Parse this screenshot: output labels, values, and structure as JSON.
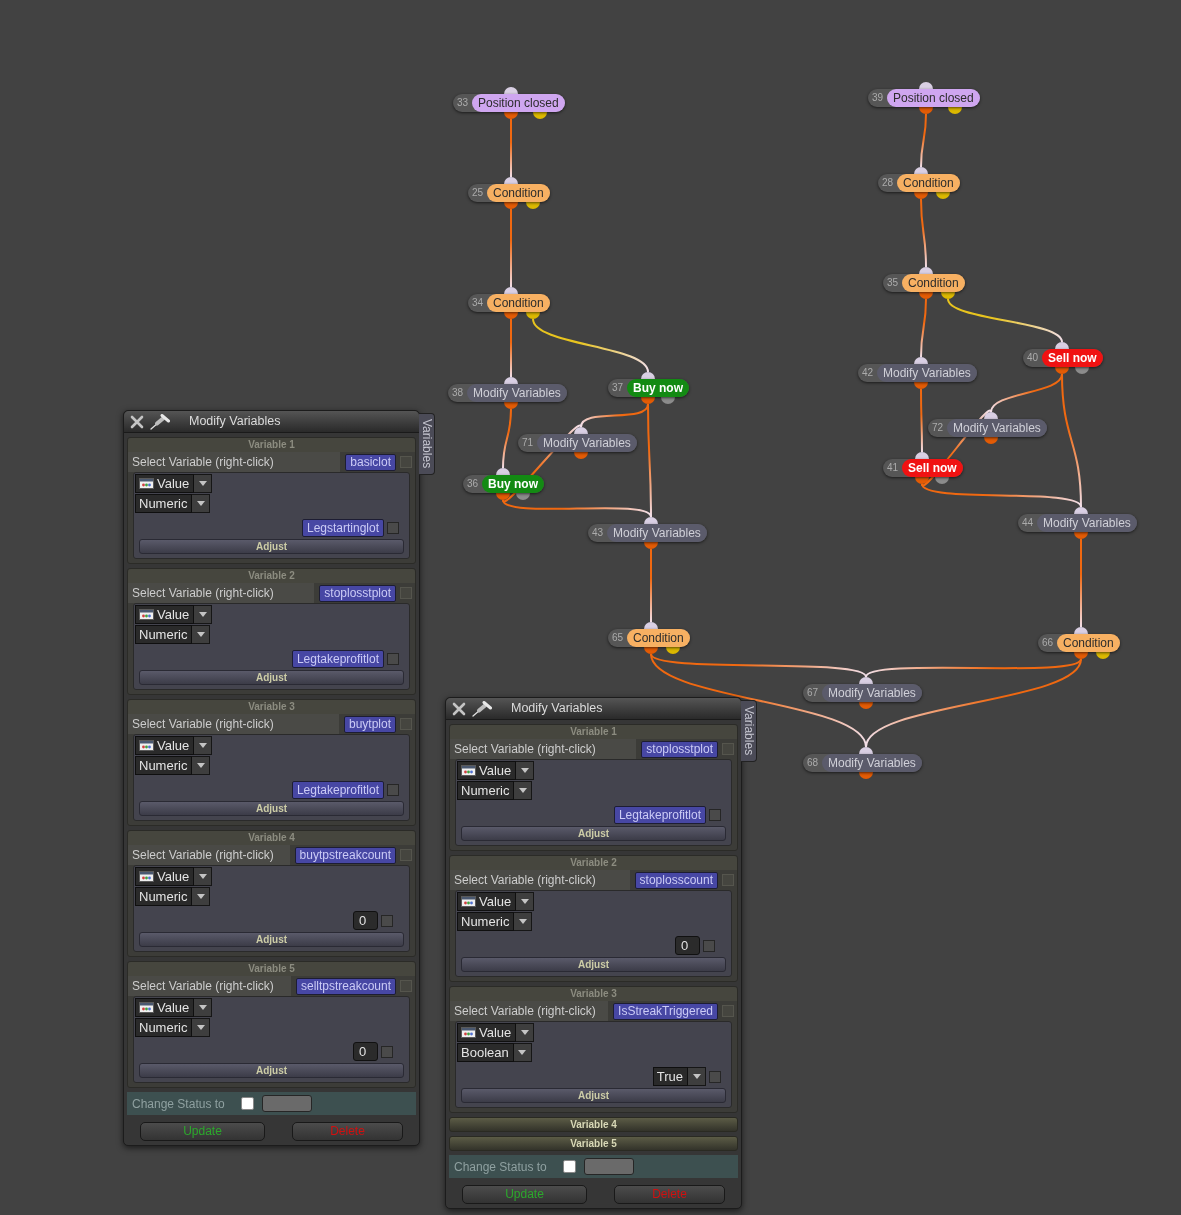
{
  "canvas": {
    "nodes": [
      {
        "number": "33",
        "label": "Position closed",
        "kind": "trigger"
      },
      {
        "number": "25",
        "label": "Condition",
        "kind": "condition"
      },
      {
        "number": "34",
        "label": "Condition",
        "kind": "condition"
      },
      {
        "number": "38",
        "label": "Modify Variables",
        "kind": "modify"
      },
      {
        "number": "37",
        "label": "Buy now",
        "kind": "buy"
      },
      {
        "number": "71",
        "label": "Modify Variables",
        "kind": "modify"
      },
      {
        "number": "36",
        "label": "Buy now",
        "kind": "buy"
      },
      {
        "number": "43",
        "label": "Modify Variables",
        "kind": "modify"
      },
      {
        "number": "39",
        "label": "Position closed",
        "kind": "trigger"
      },
      {
        "number": "28",
        "label": "Condition",
        "kind": "condition"
      },
      {
        "number": "35",
        "label": "Condition",
        "kind": "condition"
      },
      {
        "number": "42",
        "label": "Modify Variables",
        "kind": "modify"
      },
      {
        "number": "40",
        "label": "Sell now",
        "kind": "sell"
      },
      {
        "number": "72",
        "label": "Modify Variables",
        "kind": "modify"
      },
      {
        "number": "41",
        "label": "Sell now",
        "kind": "sell"
      },
      {
        "number": "44",
        "label": "Modify Variables",
        "kind": "modify"
      },
      {
        "number": "65",
        "label": "Condition",
        "kind": "condition"
      },
      {
        "number": "66",
        "label": "Condition",
        "kind": "condition"
      },
      {
        "number": "67",
        "label": "Modify Variables",
        "kind": "modify"
      },
      {
        "number": "68",
        "label": "Modify Variables",
        "kind": "modify"
      }
    ]
  },
  "panels": [
    {
      "title": "Modify Variables",
      "side_tab": "Variables",
      "variables": [
        {
          "title": "Variable 1",
          "expanded": true,
          "select_label": "Select Variable (right-click)",
          "variable": "basiclot",
          "variable_checked": false,
          "source": "Value",
          "type": "Numeric",
          "value": {
            "kind": "variable",
            "text": "Legstartinglot",
            "checked": false
          },
          "adjust": "Adjust"
        },
        {
          "title": "Variable 2",
          "expanded": true,
          "select_label": "Select Variable (right-click)",
          "variable": "stoplosstplot",
          "variable_checked": false,
          "source": "Value",
          "type": "Numeric",
          "value": {
            "kind": "variable",
            "text": "Legtakeprofitlot",
            "checked": false
          },
          "adjust": "Adjust"
        },
        {
          "title": "Variable 3",
          "expanded": true,
          "select_label": "Select Variable (right-click)",
          "variable": "buytplot",
          "variable_checked": false,
          "source": "Value",
          "type": "Numeric",
          "value": {
            "kind": "variable",
            "text": "Legtakeprofitlot",
            "checked": false
          },
          "adjust": "Adjust"
        },
        {
          "title": "Variable 4",
          "expanded": true,
          "select_label": "Select Variable (right-click)",
          "variable": "buytpstreakcount",
          "variable_checked": false,
          "source": "Value",
          "type": "Numeric",
          "value": {
            "kind": "number",
            "text": "0",
            "checked": false
          },
          "adjust": "Adjust"
        },
        {
          "title": "Variable 5",
          "expanded": true,
          "select_label": "Select Variable (right-click)",
          "variable": "selltpstreakcount",
          "variable_checked": false,
          "source": "Value",
          "type": "Numeric",
          "value": {
            "kind": "number",
            "text": "0",
            "checked": false
          },
          "adjust": "Adjust"
        }
      ],
      "status": {
        "label": "Change Status to",
        "checked": false
      },
      "buttons": [
        {
          "label": "Update",
          "kind": "confirm"
        },
        {
          "label": "Delete",
          "kind": "danger"
        }
      ]
    },
    {
      "title": "Modify Variables",
      "side_tab": "Variables",
      "variables": [
        {
          "title": "Variable 1",
          "expanded": true,
          "select_label": "Select Variable (right-click)",
          "variable": "stoplosstplot",
          "variable_checked": false,
          "source": "Value",
          "type": "Numeric",
          "value": {
            "kind": "variable",
            "text": "Legtakeprofitlot",
            "checked": false
          },
          "adjust": "Adjust"
        },
        {
          "title": "Variable 2",
          "expanded": true,
          "select_label": "Select Variable (right-click)",
          "variable": "stoplosscount",
          "variable_checked": false,
          "source": "Value",
          "type": "Numeric",
          "value": {
            "kind": "number",
            "text": "0",
            "checked": false
          },
          "adjust": "Adjust"
        },
        {
          "title": "Variable 3",
          "expanded": true,
          "select_label": "Select Variable (right-click)",
          "variable": "IsStreakTriggered",
          "variable_checked": false,
          "source": "Value",
          "type": "Boolean",
          "value": {
            "kind": "choice",
            "text": "True",
            "checked": false
          },
          "adjust": "Adjust"
        },
        {
          "title": "Variable 4",
          "expanded": false
        },
        {
          "title": "Variable 5",
          "expanded": false
        }
      ],
      "status": {
        "label": "Change Status to",
        "checked": false
      },
      "buttons": [
        {
          "label": "Update",
          "kind": "confirm"
        },
        {
          "label": "Delete",
          "kind": "danger"
        }
      ]
    }
  ]
}
